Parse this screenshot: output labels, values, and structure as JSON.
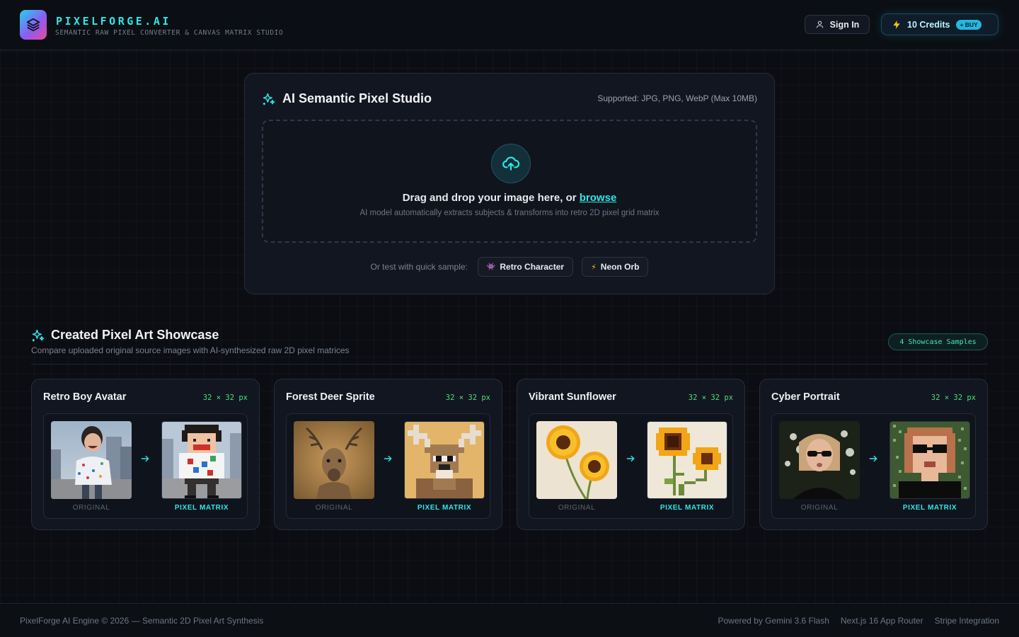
{
  "header": {
    "brand_title": "PIXELFORGE.AI",
    "brand_subtitle": "SEMANTIC RAW PIXEL CONVERTER & CANVAS MATRIX STUDIO",
    "sign_in_label": "Sign In",
    "credits_label": "10 Credits",
    "buy_label": "+ BUY"
  },
  "studio": {
    "title": "AI Semantic Pixel Studio",
    "supported": "Supported: JPG, PNG, WebP (Max 10MB)",
    "drop_text": "Drag and drop your image here, or",
    "browse_label": "browse",
    "drop_hint": "AI model automatically extracts subjects & transforms into retro 2D pixel grid matrix",
    "quick_label": "Or test with quick sample:",
    "samples": [
      {
        "icon": "👾",
        "label": "Retro Character"
      },
      {
        "icon": "⚡",
        "label": "Neon Orb"
      }
    ]
  },
  "showcase": {
    "title": "Created Pixel Art Showcase",
    "subtitle": "Compare uploaded original source images with AI-synthesized raw 2D pixel matrices",
    "badge": "4 Showcase Samples",
    "original_label": "ORIGINAL",
    "pixel_label": "PIXEL MATRIX",
    "cards": [
      {
        "title": "Retro Boy Avatar",
        "size": "32 × 32 px"
      },
      {
        "title": "Forest Deer Sprite",
        "size": "32 × 32 px"
      },
      {
        "title": "Vibrant Sunflower",
        "size": "32 × 32 px"
      },
      {
        "title": "Cyber Portrait",
        "size": "32 × 32 px"
      }
    ]
  },
  "footer": {
    "copyright": "PixelForge AI Engine © 2026 — Semantic 2D Pixel Art Synthesis",
    "links": [
      "Powered by Gemini 3.6 Flash",
      "Next.js 16 App Router",
      "Stripe Integration"
    ]
  },
  "colors": {
    "accent": "#2ee6e6",
    "size_green": "#46e07a",
    "background": "#0b0d12"
  }
}
